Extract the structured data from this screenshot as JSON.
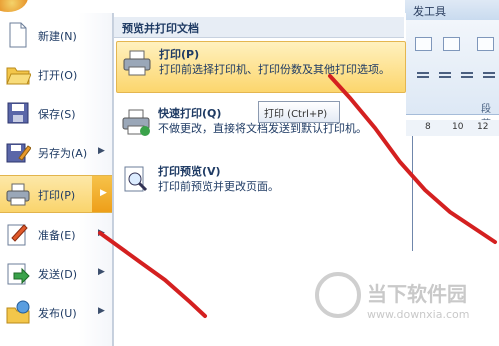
{
  "ribbon": {
    "title_partial": "发工具",
    "group_label": "段落",
    "ruler_ticks": [
      "8",
      "10",
      "12"
    ]
  },
  "left_menu": {
    "items": [
      {
        "label": "新建(N)",
        "icon": "new-document-icon",
        "has_arrow": false
      },
      {
        "label": "打开(O)",
        "icon": "open-folder-icon",
        "has_arrow": false
      },
      {
        "label": "保存(S)",
        "icon": "save-icon",
        "has_arrow": false
      },
      {
        "label": "另存为(A)",
        "icon": "save-as-icon",
        "has_arrow": true
      },
      {
        "label": "打印(P)",
        "icon": "printer-icon",
        "has_arrow": true,
        "active": true
      },
      {
        "label": "准备(E)",
        "icon": "prepare-icon",
        "has_arrow": true
      },
      {
        "label": "发送(D)",
        "icon": "send-icon",
        "has_arrow": true
      },
      {
        "label": "发布(U)",
        "icon": "publish-icon",
        "has_arrow": true
      }
    ]
  },
  "sub_menu": {
    "header": "预览并打印文档",
    "items": [
      {
        "title": "打印(P)",
        "desc": "打印前选择打印机、打印份数及其他打印选项。",
        "icon": "printer-icon"
      },
      {
        "title": "快速打印(Q)",
        "desc": "不做更改，直接将文档发送到默认打印机。",
        "icon": "quick-print-icon"
      },
      {
        "title": "打印预览(V)",
        "desc": "打印前预览并更改页面。",
        "icon": "print-preview-icon"
      }
    ]
  },
  "tooltip": {
    "text": "打印 (Ctrl+P)"
  },
  "watermark": {
    "name": "当下软件园",
    "url": "www.downxia.com"
  },
  "colors": {
    "highlight": "#fcd66d",
    "annotation": "#d42020"
  }
}
